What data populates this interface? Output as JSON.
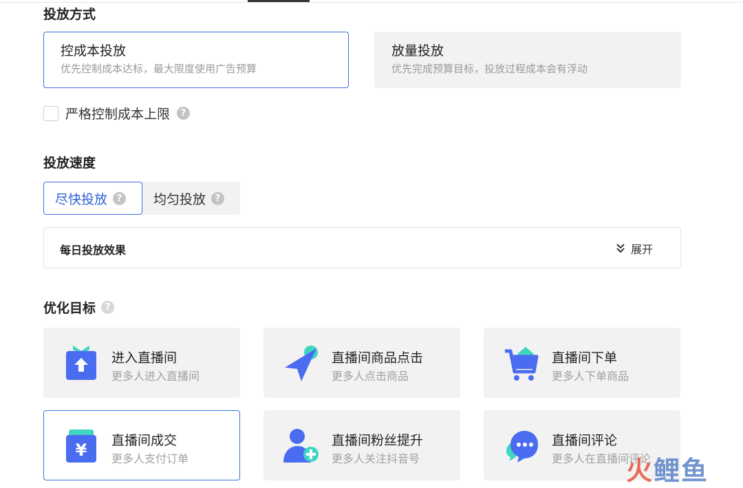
{
  "delivery_method": {
    "title": "投放方式",
    "options": [
      {
        "title": "控成本投放",
        "desc": "优先控制成本达标，最大限度使用广告预算",
        "selected": true
      },
      {
        "title": "放量投放",
        "desc": "优先完成预算目标，投放过程成本会有浮动",
        "selected": false
      }
    ],
    "strict_cost_label": "严格控制成本上限"
  },
  "delivery_speed": {
    "title": "投放速度",
    "options": [
      {
        "label": "尽快投放",
        "selected": true
      },
      {
        "label": "均匀投放",
        "selected": false
      }
    ]
  },
  "daily_effects": {
    "title": "每日投放效果",
    "expand_label": "展开"
  },
  "optimization_goal": {
    "title": "优化目标",
    "goals": [
      {
        "title": "进入直播间",
        "desc": "更多人进入直播间",
        "icon": "live-enter-icon",
        "selected": false
      },
      {
        "title": "直播间商品点击",
        "desc": "更多人点击商品",
        "icon": "product-click-icon",
        "selected": false
      },
      {
        "title": "直播间下单",
        "desc": "更多人下单商品",
        "icon": "cart-icon",
        "selected": false
      },
      {
        "title": "直播间成交",
        "desc": "更多人支付订单",
        "icon": "yuan-wallet-icon",
        "selected": true
      },
      {
        "title": "直播间粉丝提升",
        "desc": "更多人关注抖音号",
        "icon": "add-follower-icon",
        "selected": false
      },
      {
        "title": "直播间评论",
        "desc": "更多人在直播间评论",
        "icon": "comment-bubble-icon",
        "selected": false
      }
    ]
  },
  "help_glyph": "?",
  "watermark": {
    "part1": "火",
    "part2": "鲤鱼"
  },
  "colors": {
    "accent": "#3b6fe0",
    "icon_blue": "#4a6cf0",
    "icon_teal": "#3ed6c0"
  }
}
